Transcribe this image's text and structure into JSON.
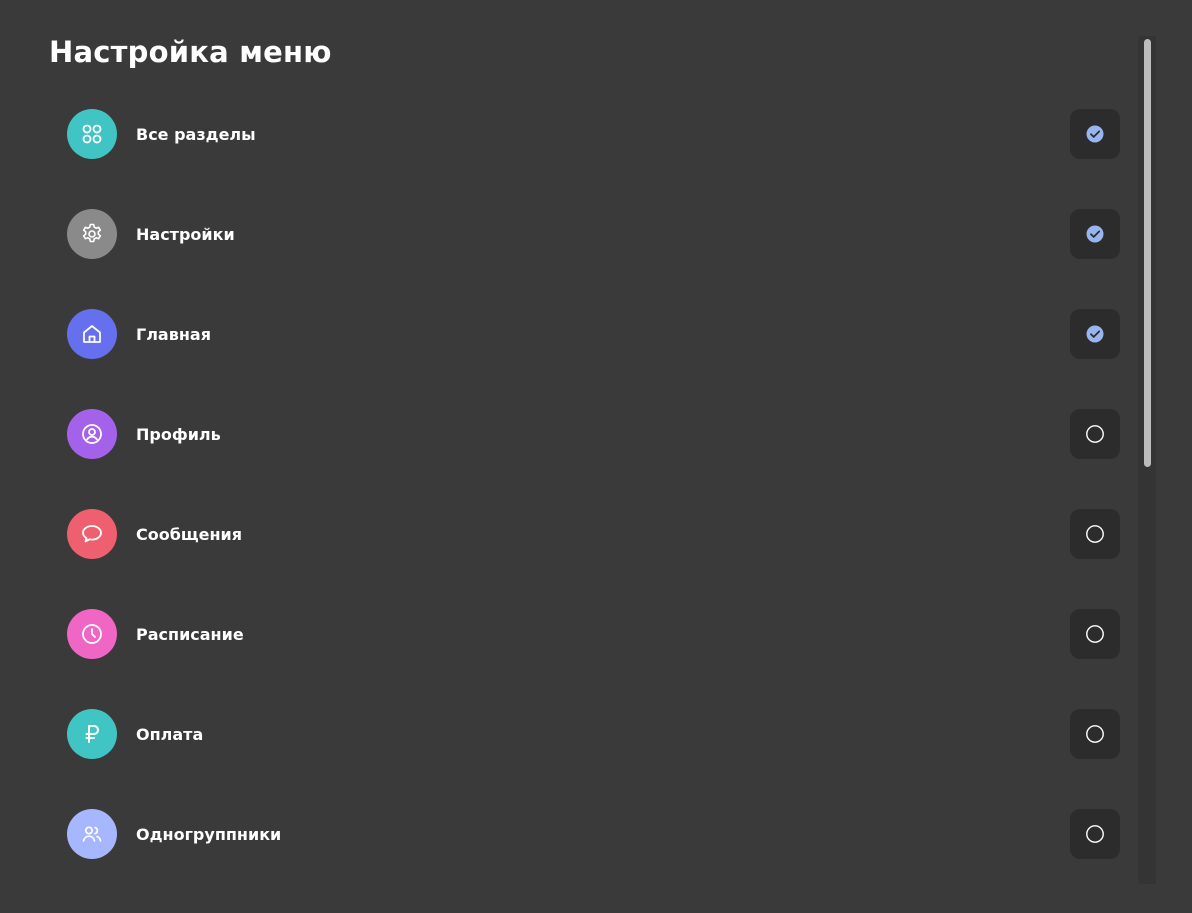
{
  "header": {
    "title": "Настройка меню"
  },
  "items": [
    {
      "label": "Все разделы",
      "icon": "grid-icon",
      "color": "#40c4c4",
      "checked": true
    },
    {
      "label": "Настройки",
      "icon": "gear-icon",
      "color": "#8a8a8a",
      "checked": true
    },
    {
      "label": "Главная",
      "icon": "home-icon",
      "color": "#6670ee",
      "checked": true
    },
    {
      "label": "Профиль",
      "icon": "profile-icon",
      "color": "#a462ea",
      "checked": false
    },
    {
      "label": "Сообщения",
      "icon": "message-icon",
      "color": "#ee6070",
      "checked": false
    },
    {
      "label": "Расписание",
      "icon": "clock-icon",
      "color": "#ef66c4",
      "checked": false
    },
    {
      "label": "Оплата",
      "icon": "ruble-icon",
      "color": "#40c4c4",
      "checked": false
    },
    {
      "label": "Одногруппники",
      "icon": "users-icon",
      "color": "#a6b6ff",
      "checked": false
    }
  ],
  "colors": {
    "background": "#3a3a3a",
    "check_box_bg": "#2c2c2c",
    "check_accent": "#97b6f0",
    "scrollbar_thumb": "#bcbcbc"
  }
}
